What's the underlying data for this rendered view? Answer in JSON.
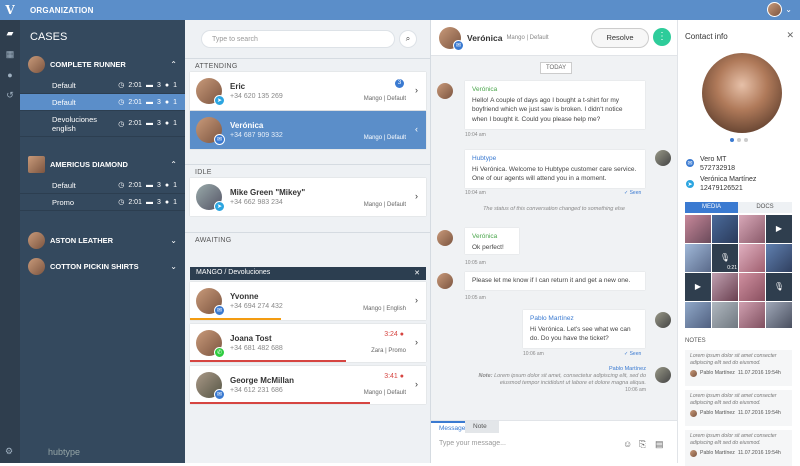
{
  "topbar": {
    "logo": "V",
    "org": "ORGANIZATION",
    "user_chevron": "⌄"
  },
  "sidebar": {
    "title": "CASES",
    "groups": [
      {
        "name": "COMPLETE RUNNER",
        "subs": [
          {
            "label": "Default",
            "time": "2:01",
            "msgs": "3",
            "users": "1"
          },
          {
            "label": "Default",
            "time": "2:01",
            "msgs": "3",
            "users": "1"
          },
          {
            "label": "Devoluciones english",
            "time": "2:01",
            "msgs": "3",
            "users": "1"
          }
        ]
      },
      {
        "name": "AMERICUS DIAMOND",
        "subs": [
          {
            "label": "Default",
            "time": "2:01",
            "msgs": "3",
            "users": "1"
          },
          {
            "label": "Promo",
            "time": "2:01",
            "msgs": "3",
            "users": "1"
          }
        ]
      },
      {
        "name": "ASTON LEATHER"
      },
      {
        "name": "COTTON PICKIN SHIRTS"
      }
    ],
    "brand": "hubtype"
  },
  "list": {
    "search_placeholder": "Type to search",
    "attending_label": "ATTENDING",
    "idle_label": "IDLE",
    "awaiting_label": "AWAITING",
    "queue_label": "MANGO / Devoluciones",
    "attending": [
      {
        "name": "Eric",
        "phone": "+34 620 135 269",
        "meta": "Mango | Default",
        "badge": "3"
      },
      {
        "name": "Verónica",
        "phone": "+34 687 909 332",
        "meta": "Mango | Default"
      }
    ],
    "idle": [
      {
        "name": "Mike Green \"Mikey\"",
        "phone": "+34 662 983 234",
        "meta": "Mango | Default"
      }
    ],
    "awaiting": [
      {
        "name": "Yvonne",
        "phone": "+34 694 274 432",
        "meta": "Mango | English"
      },
      {
        "name": "Joana Tost",
        "phone": "+34 681 482 688",
        "meta": "Zara | Promo",
        "time": "3:24"
      },
      {
        "name": "George McMillan",
        "phone": "+34 612 231 686",
        "meta": "Mango | Default",
        "time": "3:41"
      }
    ]
  },
  "chat": {
    "name": "Verónica",
    "tag": "Mango | Default",
    "resolve": "Resolve",
    "today": "TODAY",
    "m1_who": "Verónica",
    "m1_text": "Hello! A couple of days ago I bought a t-shirt for my boyfriend which we just saw is broken. I didn't notice when I bought it. Could you please help me?",
    "m1_ts": "10:04 am",
    "m2_who": "Hubtype",
    "m2_text": "Hi Verónica. Welcome to Hubtype customer care service. One of our agents will attend you in a moment.",
    "m2_ts": "10:04 am",
    "m2_seen": "✓ Seen",
    "status": "The status of this conversation changed to something else",
    "m3_who": "Verónica",
    "m3_text": "Ok perfect!",
    "m3_ts": "10:05 am",
    "m4_text": "Please let me know if I can return it and get a new one.",
    "m4_ts": "10:05 am",
    "m5_who": "Pablo Martínez",
    "m5_text": "Hi Verónica. Let's see what we can do. Do you have the ticket?",
    "m5_ts": "10:06 am",
    "m5_seen": "✓ Seen",
    "note_who": "Pablo Martínez",
    "note_label": "Note:",
    "note_text": "Lorem ipsum dolor sit amet, consectetur adipiscing elit, sed do eiusmod tempor incididunt ut labore et dolore magna aliqua.",
    "note_ts": "10:06 am",
    "tab_message": "Message",
    "tab_note": "Note",
    "compose_placeholder": "Type your message..."
  },
  "info": {
    "title": "Contact info",
    "c1_name": "Vero MT",
    "c1_id": "572732918",
    "c2_name": "Verónica Martínez",
    "c2_id": "12479126521",
    "tab_media": "MEDIA",
    "tab_docs": "DOCS",
    "notes_label": "NOTES",
    "note_text": "Lorem ipsum dolor sit amet consecter adipiscing elit sed do eiusmod.",
    "note_by": "Pablo Martínez",
    "note_date": "11.07.2016 19:54h",
    "video_time": "0:21"
  },
  "colors": {
    "topbar": "#5b8ec9",
    "sidebar": "#34495e",
    "accent": "#3a7ad1",
    "alert": "#d64541",
    "teal": "#2ecc9a"
  }
}
